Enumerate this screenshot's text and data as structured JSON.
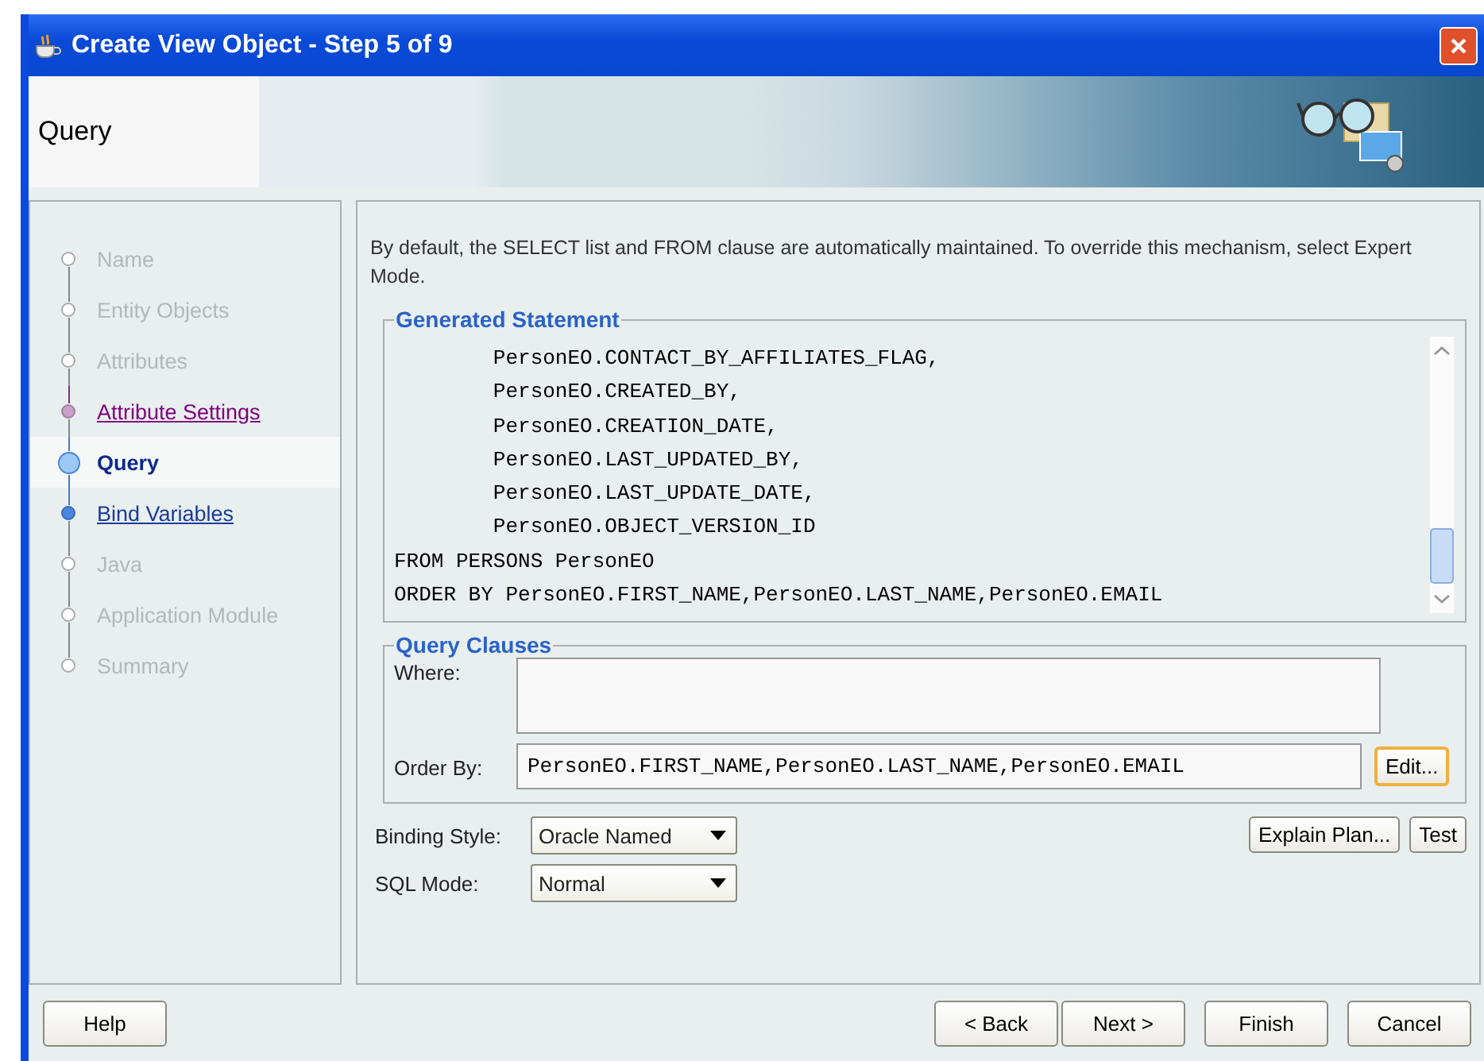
{
  "window": {
    "title": "Create View Object - Step 5 of 9"
  },
  "header": {
    "title": "Query"
  },
  "steps": [
    {
      "label": "Name",
      "kind": "disabled"
    },
    {
      "label": "Entity Objects",
      "kind": "disabled"
    },
    {
      "label": "Attributes",
      "kind": "disabled"
    },
    {
      "label": "Attribute Settings",
      "kind": "visited"
    },
    {
      "label": "Query",
      "kind": "current"
    },
    {
      "label": "Bind Variables",
      "kind": "link"
    },
    {
      "label": "Java",
      "kind": "disabled"
    },
    {
      "label": "Application Module",
      "kind": "disabled"
    },
    {
      "label": "Summary",
      "kind": "disabled"
    }
  ],
  "description": "By default, the SELECT list and FROM clause are automatically maintained.  To override this mechanism, select Expert Mode.",
  "generated_statement": {
    "title": "Generated Statement",
    "lines": [
      "        PersonEO.CONTACT_BY_AFFILIATES_FLAG,",
      "        PersonEO.CREATED_BY,",
      "        PersonEO.CREATION_DATE,",
      "        PersonEO.LAST_UPDATED_BY,",
      "        PersonEO.LAST_UPDATE_DATE,",
      "        PersonEO.OBJECT_VERSION_ID",
      "FROM PERSONS PersonEO",
      "ORDER BY PersonEO.FIRST_NAME,PersonEO.LAST_NAME,PersonEO.EMAIL"
    ]
  },
  "query_clauses": {
    "title": "Query Clauses",
    "where": {
      "label": "Where:"
    },
    "order_by": {
      "label": "Order By:",
      "value": "PersonEO.FIRST_NAME,PersonEO.LAST_NAME,PersonEO.EMAIL",
      "button": {
        "label": "Edit...",
        "focused": true
      }
    }
  },
  "binding_style": {
    "label": "Binding Style:",
    "value": "Oracle Named"
  },
  "sql_mode": {
    "label": "SQL Mode:",
    "value": "Normal"
  },
  "side_buttons": [
    "Explain Plan...",
    "Test"
  ],
  "footer": {
    "left_buttons": [
      "Help"
    ],
    "right_buttons": [
      "< Back",
      "Next >",
      "Finish",
      "Cancel"
    ]
  }
}
